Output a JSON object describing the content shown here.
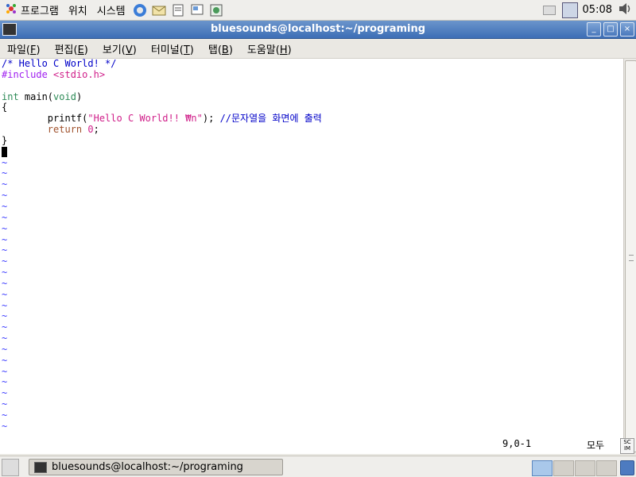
{
  "top_panel": {
    "menus": [
      {
        "label": "프로그램"
      },
      {
        "label": "위치"
      },
      {
        "label": "시스템"
      }
    ],
    "clock": "05:08"
  },
  "window": {
    "title": "bluesounds@localhost:~/programing",
    "buttons": {
      "minimize": "_",
      "maximize": "□",
      "close": "×"
    }
  },
  "menubar": [
    {
      "label": "파일",
      "key": "F"
    },
    {
      "label": "편집",
      "key": "E"
    },
    {
      "label": "보기",
      "key": "V"
    },
    {
      "label": "터미널",
      "key": "T"
    },
    {
      "label": "탭",
      "key": "B"
    },
    {
      "label": "도움말",
      "key": "H"
    }
  ],
  "editor": {
    "lines": [
      "/* Hello C World! */",
      "#include <stdio.h>",
      "",
      "int main(void)",
      "{",
      "        printf(\"Hello C World!! ₩n\"); //문자열을 화면에 출력",
      "        return 0;",
      "}",
      ""
    ],
    "tilde": "~",
    "tilde_count": 25,
    "status_position": "9,0-1",
    "status_scroll": "모두"
  },
  "taskbar": {
    "task_label": "bluesounds@localhost:~/programing"
  },
  "colors": {
    "title_bar": "#3d6eb6",
    "comment": "#0000c8",
    "preproc": "#a020f0",
    "string": "#d0208a"
  }
}
